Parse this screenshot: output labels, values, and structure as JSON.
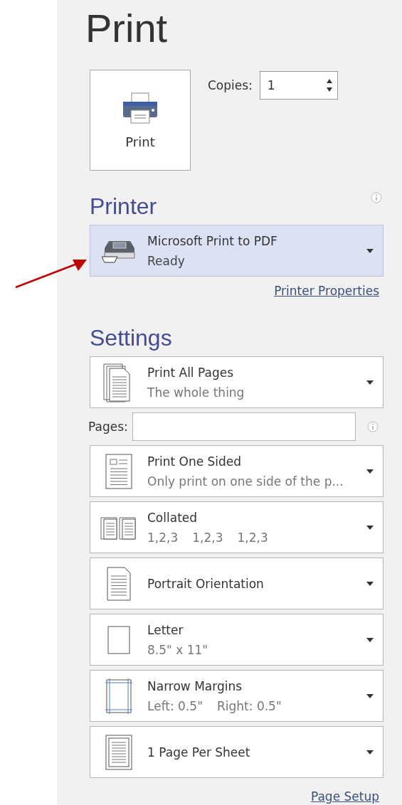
{
  "title": "Print",
  "print_button": {
    "label": "Print"
  },
  "copies": {
    "label": "Copies:",
    "value": "1"
  },
  "printer": {
    "heading": "Printer",
    "name": "Microsoft Print to PDF",
    "status": "Ready",
    "properties_link": "Printer Properties"
  },
  "settings": {
    "heading": "Settings",
    "items": [
      {
        "kind": "pages",
        "title": "Print All Pages",
        "detail": "The whole thing"
      },
      {
        "kind": "page-range",
        "label": "Pages:"
      },
      {
        "kind": "sides",
        "title": "Print One Sided",
        "detail": "Only print on one side of the p..."
      },
      {
        "kind": "collate",
        "title": "Collated",
        "details": [
          "1,2,3",
          "1,2,3",
          "1,2,3"
        ]
      },
      {
        "kind": "orientation",
        "title": "Portrait Orientation"
      },
      {
        "kind": "paper",
        "title": "Letter",
        "detail": "8.5\" x 11\""
      },
      {
        "kind": "margins",
        "title": "Narrow Margins",
        "details": [
          "Left:  0.5\"",
          "Right:  0.5\""
        ]
      },
      {
        "kind": "per-sheet",
        "title": "1 Page Per Sheet"
      }
    ],
    "setup_link": "Page Setup"
  }
}
